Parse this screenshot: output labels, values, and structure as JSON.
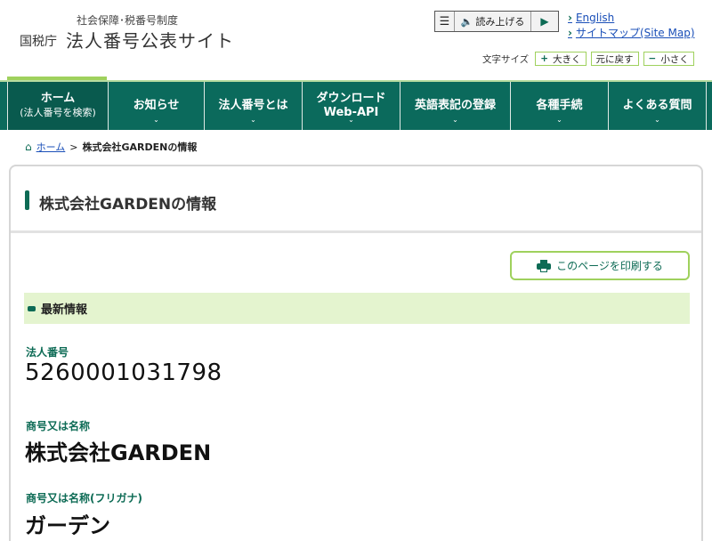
{
  "header": {
    "subtitle": "社会保障･税番号制度",
    "agency": "国税庁",
    "site_name": "法人番号公表サイト"
  },
  "speech_tool": {
    "menu_icon": "menu-icon",
    "read_label": "読み上げる",
    "play_icon": "play-icon"
  },
  "top_links": {
    "english": "English",
    "sitemap": "サイトマップ(Site Map)"
  },
  "font_size": {
    "label": "文字サイズ",
    "larger": "大きく",
    "reset": "元に戻す",
    "smaller": "小さく"
  },
  "nav": {
    "home_line1": "ホーム",
    "home_line2": "(法人番号を検索)",
    "news": "お知らせ",
    "about": "法人番号とは",
    "download_line1": "ダウンロード",
    "download_line2": "Web-API",
    "english_reg": "英語表記の登録",
    "procedures": "各種手続",
    "faq": "よくある質問"
  },
  "breadcrumb": {
    "home": "ホーム",
    "separator": ">",
    "current": "株式会社GARDENの情報"
  },
  "page": {
    "title": "株式会社GARDENの情報",
    "print_label": "このページを印刷する",
    "section_title": "最新情報"
  },
  "fields": {
    "corp_number_label": "法人番号",
    "corp_number": "5260001031798",
    "name_label": "商号又は名称",
    "name": "株式会社GARDEN",
    "kana_label": "商号又は名称(フリガナ)",
    "kana": "ガーデン"
  },
  "colors": {
    "brand_green": "#0b6a5c",
    "accent_lime": "#9fd15d",
    "section_bg": "#e4f4cf",
    "link_blue": "#1a4fb8"
  }
}
